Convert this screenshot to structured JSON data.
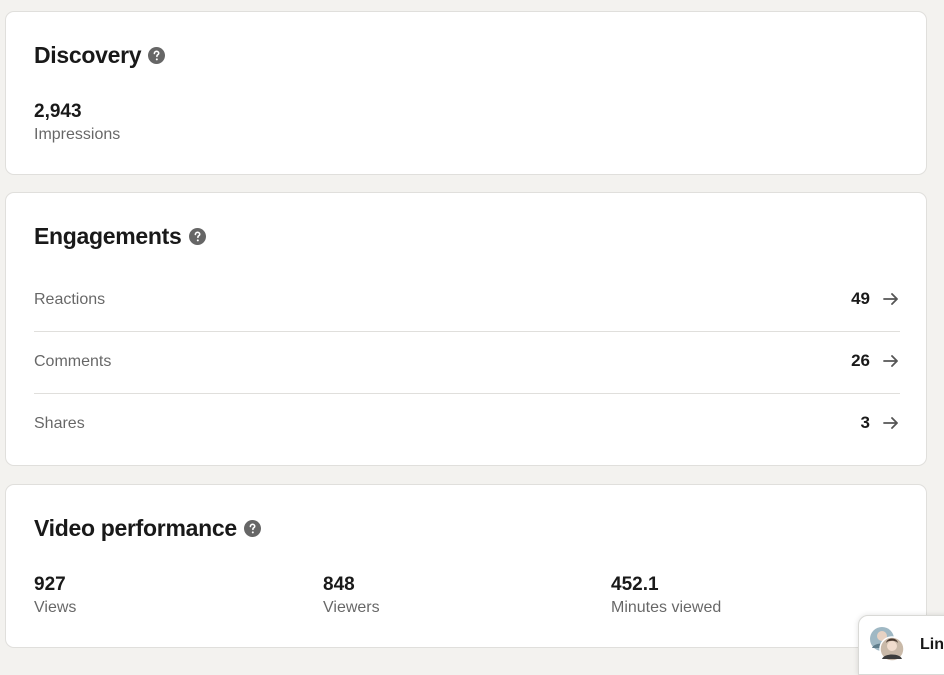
{
  "discovery": {
    "title": "Discovery",
    "help_icon": "question-circle-icon",
    "impressions_value": "2,943",
    "impressions_label": "Impressions"
  },
  "engagements": {
    "title": "Engagements",
    "help_icon": "question-circle-icon",
    "rows": [
      {
        "label": "Reactions",
        "count": "49",
        "icon": "arrow-right-icon"
      },
      {
        "label": "Comments",
        "count": "26",
        "icon": "arrow-right-icon"
      },
      {
        "label": "Shares",
        "count": "3",
        "icon": "arrow-right-icon"
      }
    ]
  },
  "video": {
    "title": "Video performance",
    "help_icon": "question-circle-icon",
    "metrics": [
      {
        "value": "927",
        "label": "Views"
      },
      {
        "value": "848",
        "label": "Viewers"
      },
      {
        "value": "452.1",
        "label": "Minutes viewed"
      }
    ]
  },
  "messaging": {
    "label": "Lin",
    "avatar_icon": "avatar-stack-icon"
  },
  "colors": {
    "page_bg": "#f3f2ef",
    "card_bg": "#ffffff",
    "border": "#e0dfdc",
    "icon": "#666666"
  }
}
